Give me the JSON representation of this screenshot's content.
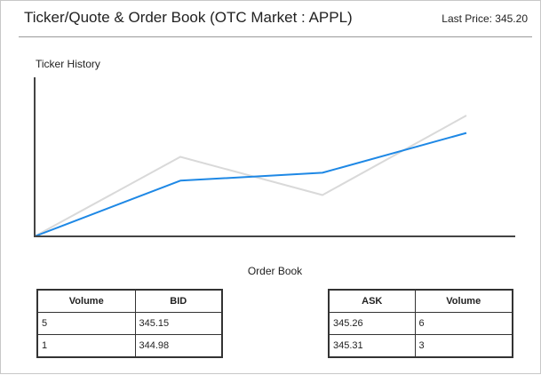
{
  "header": {
    "title": "Ticker/Quote & Order Book (OTC Market : APPL)",
    "last_price_label": "Last Price: 345.20"
  },
  "chart": {
    "label": "Ticker History"
  },
  "chart_data": {
    "type": "line",
    "x": [
      0,
      1,
      2,
      3
    ],
    "ylim": [
      0,
      100
    ],
    "series": [
      {
        "color": "#1e88e5",
        "values": [
          0,
          35,
          40,
          65
        ]
      },
      {
        "color": "#d9d9d9",
        "values": [
          0,
          50,
          26,
          76
        ]
      }
    ],
    "grid": false
  },
  "order_book": {
    "title": "Order Book",
    "bids": {
      "headers": [
        "Volume",
        "BID"
      ],
      "rows": [
        [
          "5",
          "345.15"
        ],
        [
          "1",
          "344.98"
        ]
      ]
    },
    "asks": {
      "headers": [
        "ASK",
        "Volume"
      ],
      "rows": [
        [
          "345.26",
          "6"
        ],
        [
          "345.31",
          "3"
        ]
      ]
    }
  }
}
